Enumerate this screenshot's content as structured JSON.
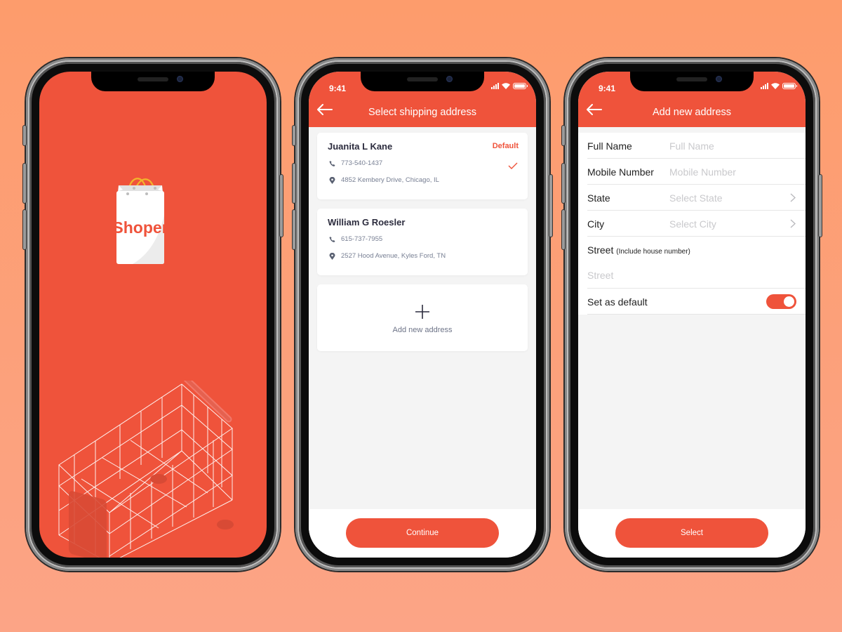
{
  "colors": {
    "brand": "#ef533b",
    "background_top": "#fd9c6c",
    "background_bottom": "#fca486"
  },
  "splash": {
    "logo_text": "Shoper",
    "logo_icon": "shopping-bag-icon",
    "illustration": "shopping-cart-icon"
  },
  "shipping": {
    "status_time": "9:41",
    "title": "Select shipping address",
    "back_icon": "arrow-left-icon",
    "addresses": [
      {
        "name": "Juanita L Kane",
        "badge": "Default",
        "phone": "773-540-1437",
        "address": "4852  Kembery Drive, Chicago, IL",
        "selected": true
      },
      {
        "name": "William G Roesler",
        "badge": "",
        "phone": "615-737-7955",
        "address": "2527  Hood Avenue, Kyles Ford, TN",
        "selected": false
      }
    ],
    "add_label": "Add new address",
    "continue_label": "Continue"
  },
  "new_address": {
    "status_time": "9:41",
    "title": "Add new address",
    "fields": {
      "full_name": {
        "label": "Full Name",
        "placeholder": "Full Name"
      },
      "mobile": {
        "label": "Mobile Number",
        "placeholder": "Mobile Number"
      },
      "state": {
        "label": "State",
        "placeholder": "Select State"
      },
      "city": {
        "label": "City",
        "placeholder": "Select City"
      },
      "street": {
        "label": "Street",
        "hint": "(Include house number)",
        "placeholder": "Street"
      }
    },
    "default_label": "Set as default",
    "default_on": true,
    "select_label": "Select"
  }
}
